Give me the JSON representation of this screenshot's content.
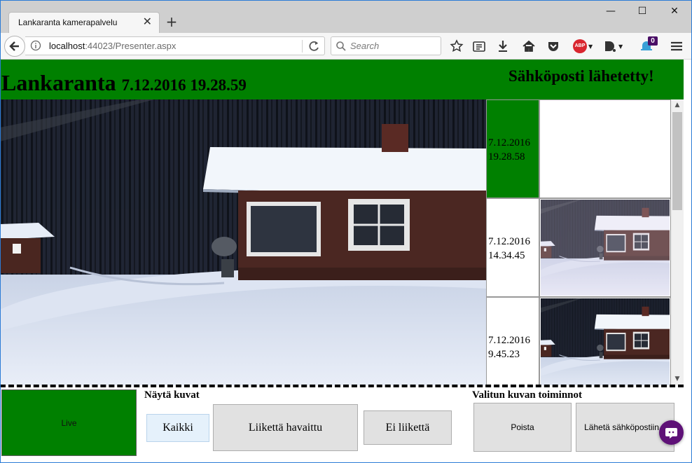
{
  "browser": {
    "tab_title": "Lankaranta kamerapalvelu",
    "url_host": "localhost",
    "url_rest": ":44023/Presenter.aspx",
    "search_placeholder": "Search",
    "addon_badge": "0",
    "abp_label": "ABP",
    "new_tab_label": "+",
    "tab_close_label": "✕",
    "window_controls": {
      "minimize": "—",
      "maximize": "☐",
      "close": "✕"
    },
    "icons": [
      "back-arrow-icon",
      "info-icon",
      "reload-icon",
      "search-icon",
      "star-icon",
      "reading-list-icon",
      "download-icon",
      "home-icon",
      "pocket-icon",
      "adblock-icon",
      "d-extension-icon",
      "notification-icon",
      "menu-icon"
    ]
  },
  "header": {
    "site_name": "Lankaranta",
    "timestamp": "7.12.2016 19.28.59",
    "status_message": "Sähköposti lähetetty!",
    "color": "#008000"
  },
  "thumbnails": [
    {
      "date": "7.12.2016",
      "time": "19.28.58",
      "selected": true
    },
    {
      "date": "7.12.2016",
      "time": "14.34.45",
      "selected": false
    },
    {
      "date": "7.12.2016",
      "time": "9.45.23",
      "selected": false
    }
  ],
  "scrollbar": {
    "up_arrow": "▲",
    "down_arrow": "▼"
  },
  "footer": {
    "live_label": "Live",
    "show_images_label": "Näytä kuvat",
    "filters": {
      "all": "Kaikki",
      "motion": "Liikettä havaittu",
      "no_motion": "Ei liikettä"
    },
    "active_filter": "all",
    "selected_actions_label": "Valitun kuvan toiminnot",
    "actions": {
      "delete": "Poista",
      "send_email": "Lähetä sähköpostiin"
    }
  }
}
